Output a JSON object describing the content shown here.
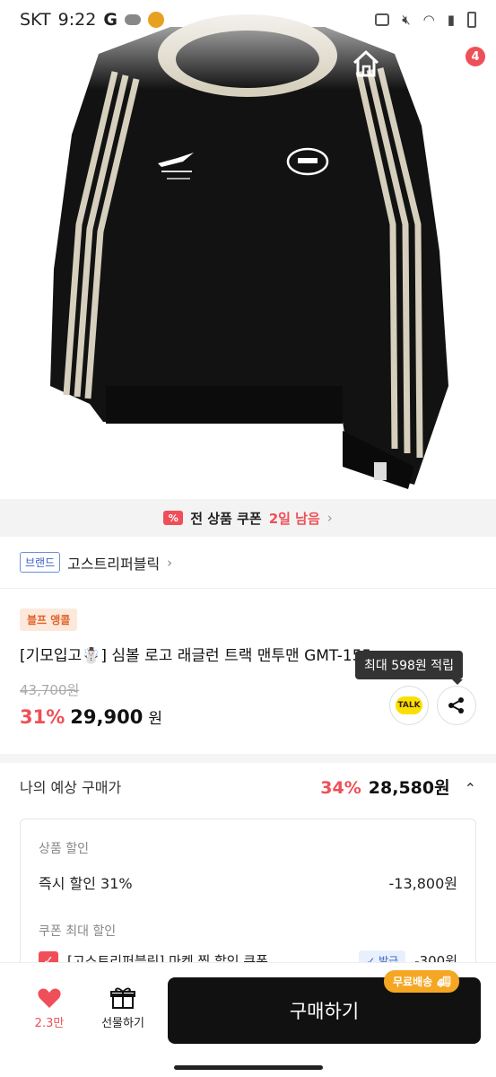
{
  "statusbar": {
    "carrier": "SKT",
    "time": "9:22",
    "g": "G"
  },
  "nav": {
    "cart_count": "4"
  },
  "coupon_bar": {
    "text": "전 상품 쿠폰",
    "highlight": "2일 남음",
    "icon": "coupon-icon"
  },
  "brand": {
    "tag": "브랜드",
    "name": "고스트리퍼블릭"
  },
  "product": {
    "chip": "블프 앵콜",
    "title": "[기모입고☃️] 심볼 로고 래글런 트랙 맨투맨 GMT-155",
    "original_price": "43,700원",
    "discount": "31%",
    "price": "29,900",
    "won": "원",
    "tooltip": "최대 598원 적립",
    "talk_label": "TALK"
  },
  "expected": {
    "label": "나의 예상 구매가",
    "rate": "34%",
    "price": "28,580원"
  },
  "details": {
    "product_discount_label": "상품 할인",
    "instant_label": "즉시 할인 31%",
    "instant_amount": "-13,800원",
    "coupon_max_label": "쿠폰 최대 할인",
    "coupon_name": "[고스트리퍼블릭] 마켓 찜 할인 쿠폰",
    "coupon_applied": "✓ 발급",
    "coupon_amount": "-300원"
  },
  "bottom": {
    "like_count": "2.3만",
    "gift_label": "선물하기",
    "buy_label": "구매하기",
    "free_shipping": "무료배송"
  },
  "colors": {
    "accent": "#ef4f58",
    "brand_blue": "#3a62c4",
    "ship": "#f5a623"
  }
}
